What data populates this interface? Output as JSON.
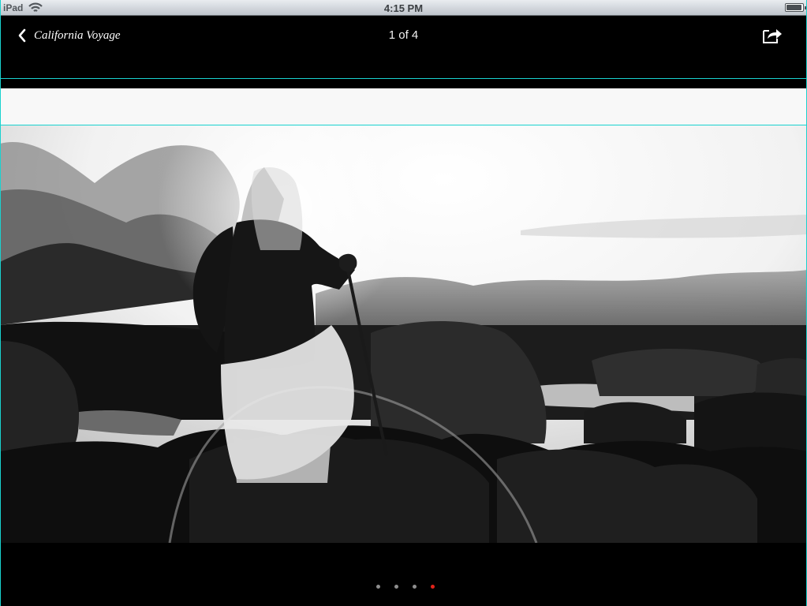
{
  "status": {
    "carrier": "iPad",
    "time": "4:15 PM",
    "wifi_icon": "wifi-icon",
    "battery_icon": "battery-icon",
    "battery_level": 0.95
  },
  "nav": {
    "back_label": "California Voyage",
    "back_icon": "chevron-left-icon",
    "counter": "1 of 4",
    "share_icon": "share-icon"
  },
  "gallery": {
    "photo_icon": "photo",
    "pages": 4,
    "active_page": 4,
    "active_color": "#e2231a",
    "inactive_color": "#8e8e8e"
  },
  "colors": {
    "frame_accent": "#19d2cf",
    "background": "#000000"
  }
}
